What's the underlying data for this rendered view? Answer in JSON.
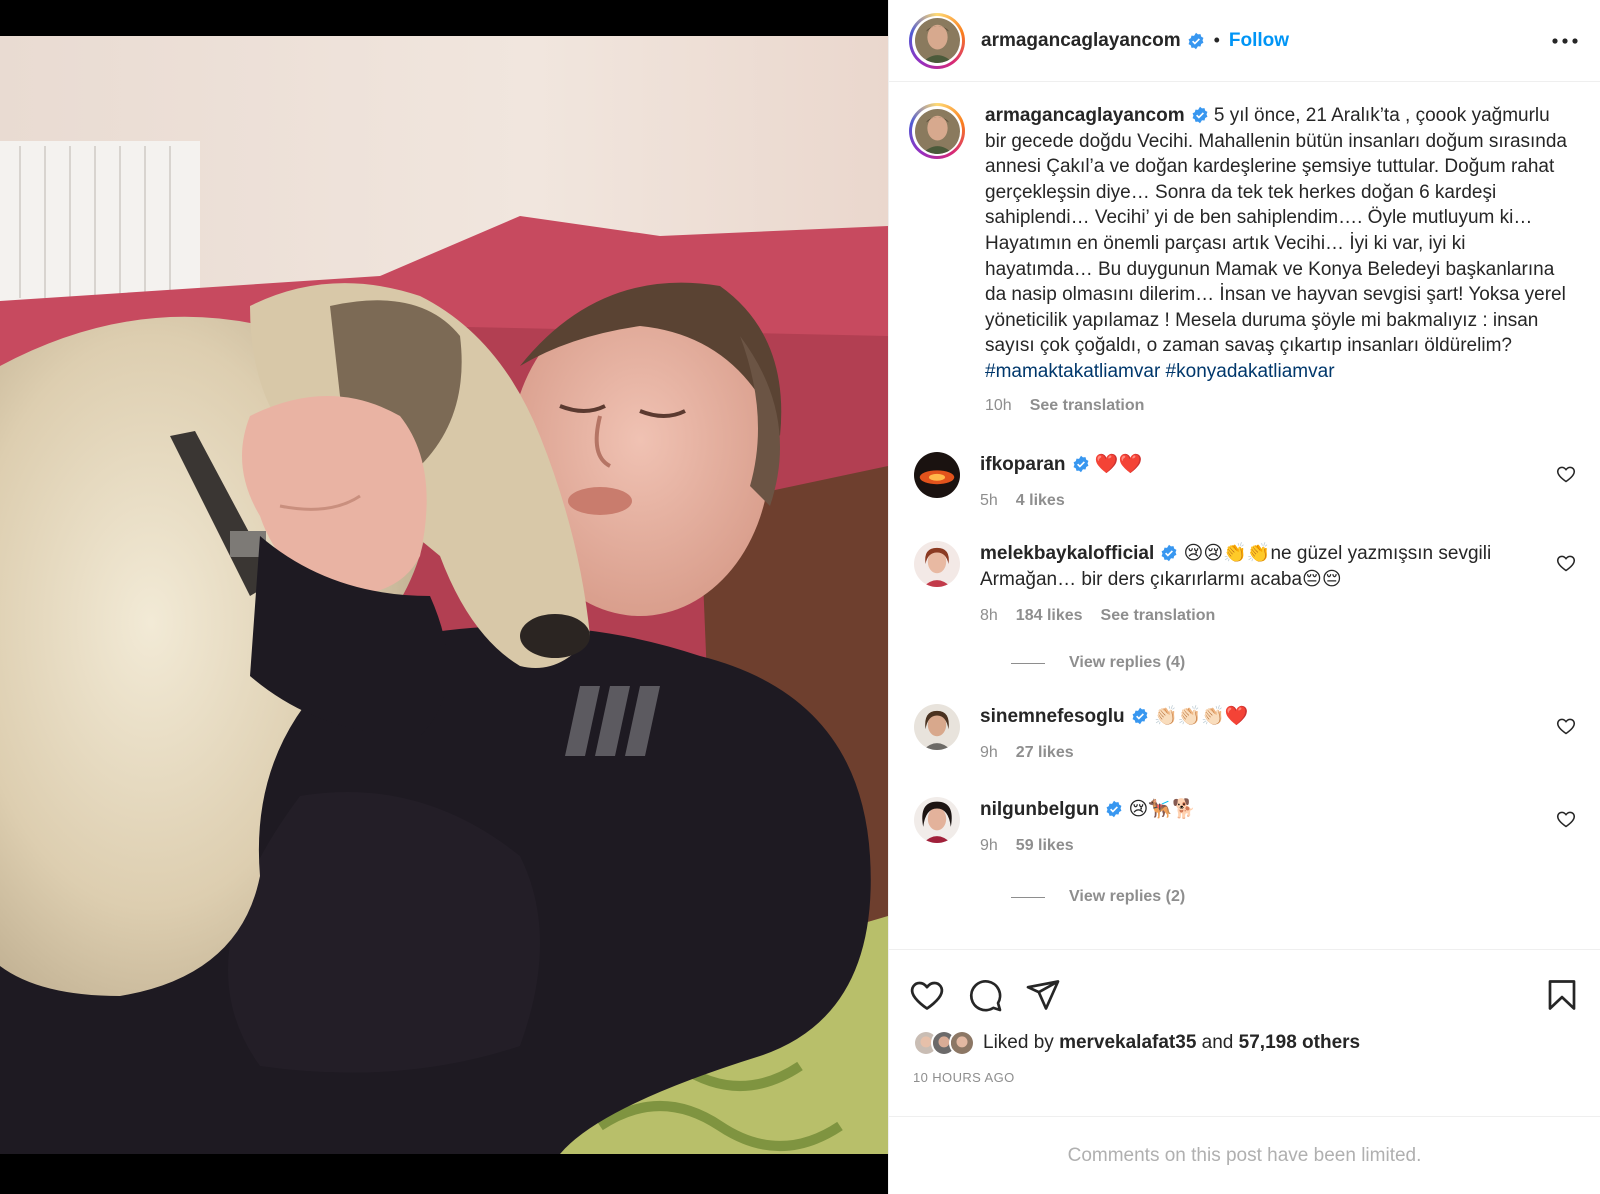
{
  "post": {
    "author": "armagancaglayancom",
    "separator": "•",
    "follow_label": "Follow",
    "caption": "5 yıl önce, 21 Aralık’ta , çoook yağmurlu bir gecede doğdu Vecihi. Mahallenin bütün insanları doğum sırasında annesi Çakıl’a ve doğan kardeşlerine şemsiye tuttular. Doğum rahat gerçekleşsin diye… Sonra da tek tek herkes doğan 6 kardeşi sahiplendi… Vecihi’ yi de ben sahiplendim…. Öyle mutluyum ki… Hayatımın en önemli parçası artık Vecihi… İyi ki var, iyi ki hayatımda… Bu duygunun Mamak ve Konya Beledeyi başkanlarına da nasip olmasını dilerim… İnsan ve hayvan sevgisi şart! Yoksa yerel yöneticilik yapılamaz ! Mesela duruma şöyle mi bakmalıyız : insan sayısı çok çoğaldı, o zaman savaş çıkartıp insanları öldürelim?",
    "hashtags": "#mamaktakatliamvar #konyadakatliamvar",
    "caption_time": "10h",
    "see_translation": "See translation"
  },
  "comments": [
    {
      "user": "ifkoparan",
      "text": "❤️❤️",
      "time": "5h",
      "likes": "4 likes"
    },
    {
      "user": "melekbaykalofficial",
      "text": "😢😢👏👏ne güzel yazmışsın sevgili Armağan… bir ders çıkarırlarmı acaba😔😔",
      "time": "8h",
      "likes": "184 likes",
      "translation": "See translation",
      "replies": "View replies (4)"
    },
    {
      "user": "sinemnefesoglu",
      "text": "👏🏻👏🏻👏🏻❤️",
      "time": "9h",
      "likes": "27 likes"
    },
    {
      "user": "nilgunbelgun",
      "text": "😢🐕‍🦺🐕",
      "time": "9h",
      "likes": "59 likes",
      "replies": "View replies (2)"
    }
  ],
  "likes": {
    "prefix": "Liked by",
    "user": "mervekalafat35",
    "and": "and",
    "others": "57,198 others"
  },
  "timestamp": "10 HOURS AGO",
  "comments_limited": "Comments on this post have been limited.",
  "icons": {
    "verified": "verified-badge-icon",
    "more": "more-options-icon",
    "like": "heart-icon",
    "comment": "comment-icon",
    "share": "share-icon",
    "save": "bookmark-icon"
  },
  "colors": {
    "link": "#0095f6",
    "hashtag": "#00376b",
    "muted": "#8e8e8e",
    "verified": "#3897f0"
  }
}
